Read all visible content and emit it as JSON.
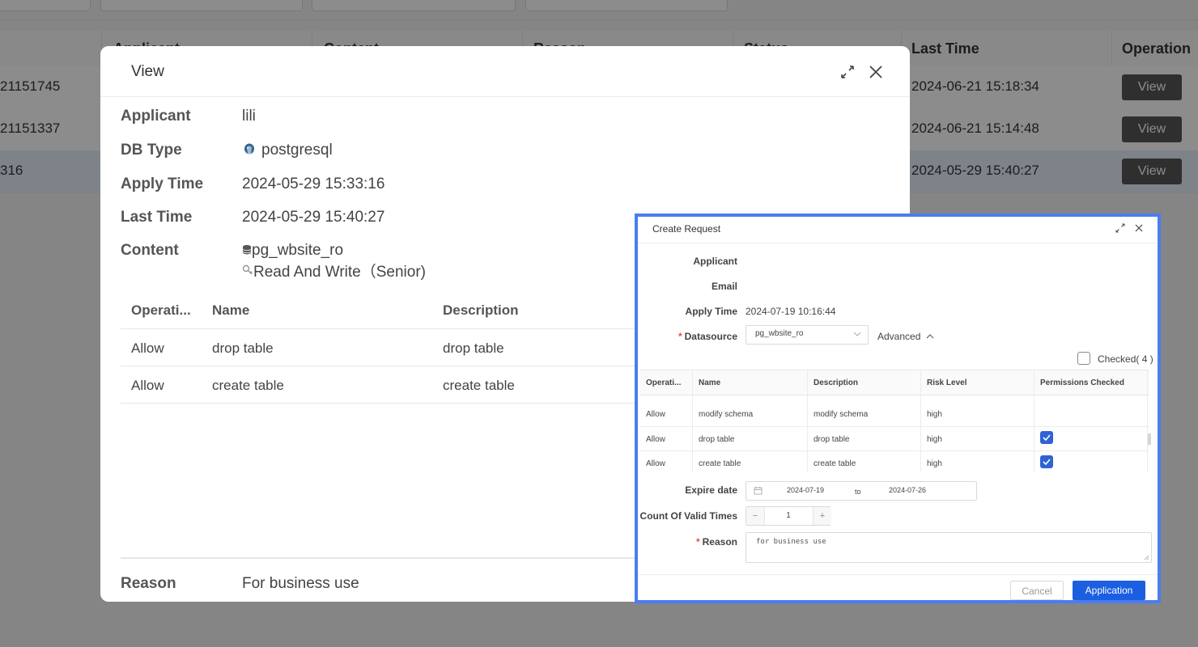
{
  "background": {
    "table_headers": [
      "Applicant",
      "Content",
      "Reason",
      "Status",
      "Last Time",
      "Operation"
    ],
    "rows": [
      {
        "id": "21151745",
        "last_time": "2024-06-21 15:18:34",
        "action": "View"
      },
      {
        "id": "21151337",
        "last_time": "2024-06-21 15:14:48",
        "action": "View"
      },
      {
        "id": "316",
        "last_time": "2024-05-29 15:40:27",
        "action": "View"
      }
    ]
  },
  "view_modal": {
    "title": "View",
    "fields": {
      "applicant_label": "Applicant",
      "applicant_value": "lili",
      "db_type_label": "DB Type",
      "db_type_value": "postgresql",
      "apply_time_label": "Apply Time",
      "apply_time_value": "2024-05-29 15:33:16",
      "last_time_label": "Last Time",
      "last_time_value": "2024-05-29 15:40:27",
      "content_label": "Content",
      "content_db": "pg_wbsite_ro",
      "content_role": "Read And Write（Senior)"
    },
    "table": {
      "headers": [
        "Operati...",
        "Name",
        "Description"
      ],
      "rows": [
        {
          "operation": "Allow",
          "name": "drop table",
          "description": "drop table"
        },
        {
          "operation": "Allow",
          "name": "create table",
          "description": "create table"
        }
      ]
    },
    "reason_label": "Reason",
    "reason_value": "For business use"
  },
  "create_request": {
    "title": "Create Request",
    "applicant_label": "Applicant",
    "email_label": "Email",
    "apply_time_label": "Apply Time",
    "apply_time_value": "2024-07-19 10:16:44",
    "datasource_label": "Datasource",
    "datasource_value": "pg_wbsite_ro",
    "advanced_label": "Advanced",
    "checked_label": "Checked( 4 )",
    "table": {
      "headers": [
        "Operati...",
        "Name",
        "Description",
        "Risk Level",
        "Permissions Checked"
      ],
      "rows": [
        {
          "operation": "Allow",
          "name": "modify schema",
          "description": "modify schema",
          "risk": "high",
          "checked": false
        },
        {
          "operation": "Allow",
          "name": "drop table",
          "description": "drop table",
          "risk": "high",
          "checked": true
        },
        {
          "operation": "Allow",
          "name": "create table",
          "description": "create table",
          "risk": "high",
          "checked": true
        }
      ]
    },
    "expire_label": "Expire date",
    "expire_start": "2024-07-19",
    "expire_to": "to",
    "expire_end": "2024-07-26",
    "count_label": "Count Of Valid Times",
    "count_value": "1",
    "count_minus": "−",
    "count_plus": "+",
    "reason_label": "Reason",
    "reason_value": "for business use",
    "cancel_label": "Cancel",
    "submit_label": "Application",
    "colors": {
      "accent": "#1b5fe0",
      "highlight_border": "#4a7df0",
      "required": "#e34d4d"
    }
  }
}
